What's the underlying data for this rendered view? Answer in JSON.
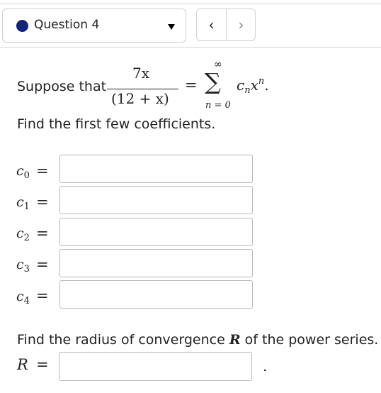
{
  "header": {
    "question_label": "Question 4",
    "prev_label": "‹",
    "next_label": "›",
    "status_color": "#12247a"
  },
  "problem": {
    "intro": "Suppose that",
    "numerator": "7x",
    "denominator": "(12 + x)",
    "equals": "=",
    "sum_upper": "∞",
    "sum_symbol": "∑",
    "sum_lower": "n = 0",
    "summand_c": "c",
    "summand_n": "n",
    "summand_x": "x",
    "summand_exp": "n",
    "period": ".",
    "find_coefficients": "Find the first few coefficients."
  },
  "coefficients": [
    {
      "symbol": "c",
      "sub": "0",
      "value": ""
    },
    {
      "symbol": "c",
      "sub": "1",
      "value": ""
    },
    {
      "symbol": "c",
      "sub": "2",
      "value": ""
    },
    {
      "symbol": "c",
      "sub": "3",
      "value": ""
    },
    {
      "symbol": "c",
      "sub": "4",
      "value": ""
    }
  ],
  "radius": {
    "prompt_before": "Find the radius of convergence",
    "symbol": "R",
    "prompt_after": "of the power series.",
    "label": "R",
    "equals": "=",
    "value": "",
    "trailing": "."
  }
}
